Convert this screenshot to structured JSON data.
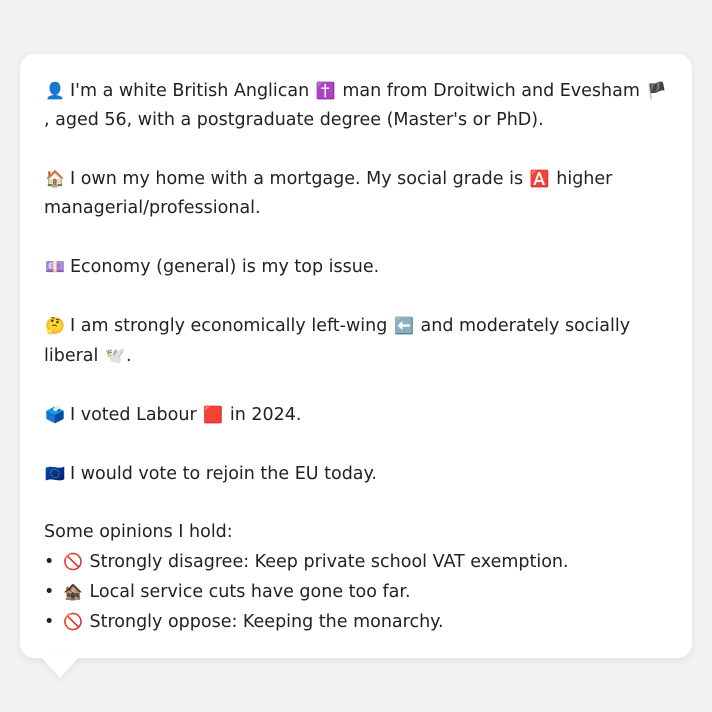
{
  "persona": {
    "identity": {
      "icon": "👤",
      "part1": "I'm a white British Anglican",
      "icon2": "✝️",
      "part2": "man from Droitwich and Evesham",
      "icon3": "🏴",
      "part3": ", aged 56, with a postgraduate degree (Master's or PhD)."
    },
    "home": {
      "icon": "🏠",
      "part1": "I own my home with a mortgage. My social grade is",
      "icon2": "🅰️",
      "part2": "higher managerial/professional."
    },
    "issue": {
      "icon": "💷",
      "text": "Economy (general) is my top issue."
    },
    "ideology": {
      "icon": "🤔",
      "part1": "I am strongly economically left-wing",
      "icon2": "⬅️",
      "part2": "and moderately socially liberal",
      "icon3": "🕊️",
      "part3": "."
    },
    "vote": {
      "icon": "🗳️",
      "part1": "I voted Labour",
      "icon2": "🟥",
      "part2": "in 2024."
    },
    "eu": {
      "icon": "🇪🇺",
      "text": "I would vote to rejoin the EU today."
    },
    "opinions_heading": "Some opinions I hold:",
    "opinions": [
      {
        "bullet": "•",
        "icon": "🚫",
        "text": "Strongly disagree: Keep private school VAT exemption."
      },
      {
        "bullet": "•",
        "icon": "🏚️",
        "text": "Local service cuts have gone too far."
      },
      {
        "bullet": "•",
        "icon": "🚫",
        "text": "Strongly oppose: Keeping the monarchy."
      }
    ]
  }
}
